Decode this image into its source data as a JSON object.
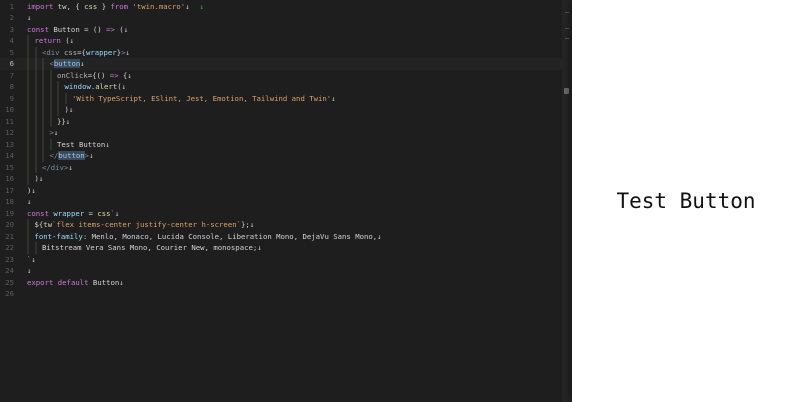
{
  "editor": {
    "active_line": 6,
    "lines": [
      {
        "n": "1",
        "indent": 0,
        "tokens": [
          {
            "t": "import",
            "c": "kw"
          },
          {
            "t": " tw, { ",
            "c": "pl"
          },
          {
            "t": "css",
            "c": "fn"
          },
          {
            "t": " } ",
            "c": "pl"
          },
          {
            "t": "from",
            "c": "kw"
          },
          {
            "t": " ",
            "c": "pl"
          },
          {
            "t": "'twin.macro'",
            "c": "str"
          },
          {
            "t": "↓",
            "c": "nl"
          }
        ]
      },
      {
        "n": "2",
        "indent": 0,
        "tokens": [
          {
            "t": "↓",
            "c": "nl"
          }
        ]
      },
      {
        "n": "3",
        "indent": 0,
        "tokens": [
          {
            "t": "const",
            "c": "kw"
          },
          {
            "t": " Button = () ",
            "c": "pl"
          },
          {
            "t": "=>",
            "c": "kw"
          },
          {
            "t": " (",
            "c": "pl"
          },
          {
            "t": "↓",
            "c": "nl"
          }
        ]
      },
      {
        "n": "4",
        "indent": 1,
        "tokens": [
          {
            "t": "return",
            "c": "kw"
          },
          {
            "t": " (",
            "c": "pl"
          },
          {
            "t": "↓",
            "c": "nl"
          }
        ]
      },
      {
        "n": "5",
        "indent": 2,
        "tokens": [
          {
            "t": "<div ",
            "c": "tag"
          },
          {
            "t": "css",
            "c": "attr"
          },
          {
            "t": "={",
            "c": "pl"
          },
          {
            "t": "wrapper",
            "c": "var"
          },
          {
            "t": "}",
            "c": "pl"
          },
          {
            "t": ">",
            "c": "tag"
          },
          {
            "t": "↓",
            "c": "nl"
          }
        ]
      },
      {
        "n": "6",
        "indent": 3,
        "tokens": [
          {
            "t": "<",
            "c": "tag"
          },
          {
            "t": "button",
            "c": "cmp",
            "hl": true
          },
          {
            "t": "↓",
            "c": "nl"
          }
        ]
      },
      {
        "n": "7",
        "indent": 4,
        "tokens": [
          {
            "t": "onClick",
            "c": "attr"
          },
          {
            "t": "={() ",
            "c": "pl"
          },
          {
            "t": "=>",
            "c": "kw"
          },
          {
            "t": " {",
            "c": "pl"
          },
          {
            "t": "↓",
            "c": "nl"
          }
        ]
      },
      {
        "n": "8",
        "indent": 5,
        "tokens": [
          {
            "t": "window",
            "c": "var"
          },
          {
            "t": ".",
            "c": "pl"
          },
          {
            "t": "alert",
            "c": "fn"
          },
          {
            "t": "(",
            "c": "pl"
          },
          {
            "t": "↓",
            "c": "nl"
          }
        ]
      },
      {
        "n": "9",
        "indent": 6,
        "tokens": [
          {
            "t": "'With TypeScript, ESlint, Jest, Emotion, Tailwind and Twin'",
            "c": "str"
          },
          {
            "t": "↓",
            "c": "nl"
          }
        ]
      },
      {
        "n": "10",
        "indent": 5,
        "tokens": [
          {
            "t": ")",
            "c": "pl"
          },
          {
            "t": "↓",
            "c": "nl"
          }
        ]
      },
      {
        "n": "11",
        "indent": 4,
        "tokens": [
          {
            "t": "}}",
            "c": "pl"
          },
          {
            "t": "↓",
            "c": "nl"
          }
        ]
      },
      {
        "n": "12",
        "indent": 3,
        "tokens": [
          {
            "t": ">",
            "c": "tag"
          },
          {
            "t": "↓",
            "c": "nl"
          }
        ]
      },
      {
        "n": "13",
        "indent": 4,
        "tokens": [
          {
            "t": "Test Button",
            "c": "pl"
          },
          {
            "t": "↓",
            "c": "nl"
          }
        ]
      },
      {
        "n": "14",
        "indent": 3,
        "tokens": [
          {
            "t": "</",
            "c": "tag"
          },
          {
            "t": "button",
            "c": "cmp",
            "hl": true
          },
          {
            "t": ">",
            "c": "tag"
          },
          {
            "t": "↓",
            "c": "nl"
          }
        ]
      },
      {
        "n": "15",
        "indent": 2,
        "tokens": [
          {
            "t": "</div>",
            "c": "tag"
          },
          {
            "t": "↓",
            "c": "nl"
          }
        ]
      },
      {
        "n": "16",
        "indent": 1,
        "tokens": [
          {
            "t": ")",
            "c": "pl"
          },
          {
            "t": "↓",
            "c": "nl"
          }
        ]
      },
      {
        "n": "17",
        "indent": 0,
        "tokens": [
          {
            "t": ")",
            "c": "pl"
          },
          {
            "t": "↓",
            "c": "nl"
          }
        ]
      },
      {
        "n": "18",
        "indent": 0,
        "tokens": [
          {
            "t": "↓",
            "c": "nl"
          }
        ]
      },
      {
        "n": "19",
        "indent": 0,
        "tokens": [
          {
            "t": "const",
            "c": "kw"
          },
          {
            "t": " ",
            "c": "pl"
          },
          {
            "t": "wrapper",
            "c": "var"
          },
          {
            "t": " = ",
            "c": "pl"
          },
          {
            "t": "css",
            "c": "fn"
          },
          {
            "t": "`",
            "c": "str"
          },
          {
            "t": "↓",
            "c": "nl"
          }
        ]
      },
      {
        "n": "20",
        "indent": 1,
        "tokens": [
          {
            "t": "${",
            "c": "pl"
          },
          {
            "t": "tw",
            "c": "fn"
          },
          {
            "t": "`flex items-center justify-center h-screen`",
            "c": "str"
          },
          {
            "t": "}",
            "c": "pl"
          },
          {
            "t": ";",
            "c": "pl"
          },
          {
            "t": "↓",
            "c": "nl"
          }
        ]
      },
      {
        "n": "21",
        "indent": 1,
        "tokens": [
          {
            "t": "font-family",
            "c": "prop"
          },
          {
            "t": ": Menlo, Monaco, Lucida Console, Liberation Mono, DejaVu Sans Mono,",
            "c": "pl"
          },
          {
            "t": "↓",
            "c": "nl"
          }
        ]
      },
      {
        "n": "22",
        "indent": 2,
        "tokens": [
          {
            "t": "Bitstream Vera Sans Mono, Courier New, monospace;",
            "c": "pl"
          },
          {
            "t": "↓",
            "c": "nl"
          }
        ]
      },
      {
        "n": "23",
        "indent": 0,
        "tokens": [
          {
            "t": "`",
            "c": "str"
          },
          {
            "t": "↓",
            "c": "nl"
          }
        ]
      },
      {
        "n": "24",
        "indent": 0,
        "tokens": [
          {
            "t": "↓",
            "c": "nl"
          }
        ]
      },
      {
        "n": "25",
        "indent": 0,
        "tokens": [
          {
            "t": "export",
            "c": "kw"
          },
          {
            "t": " ",
            "c": "pl"
          },
          {
            "t": "default",
            "c": "kw"
          },
          {
            "t": " Button",
            "c": "pl"
          },
          {
            "t": "↓",
            "c": "nl"
          }
        ]
      },
      {
        "n": "26",
        "indent": 0,
        "tokens": []
      }
    ]
  },
  "preview": {
    "button_label": "Test Button"
  },
  "colors": {
    "editor_bg": "#1e1e1e",
    "preview_bg": "#ffffff",
    "keyword": "#cc7ad6",
    "string": "#d7a46c"
  }
}
